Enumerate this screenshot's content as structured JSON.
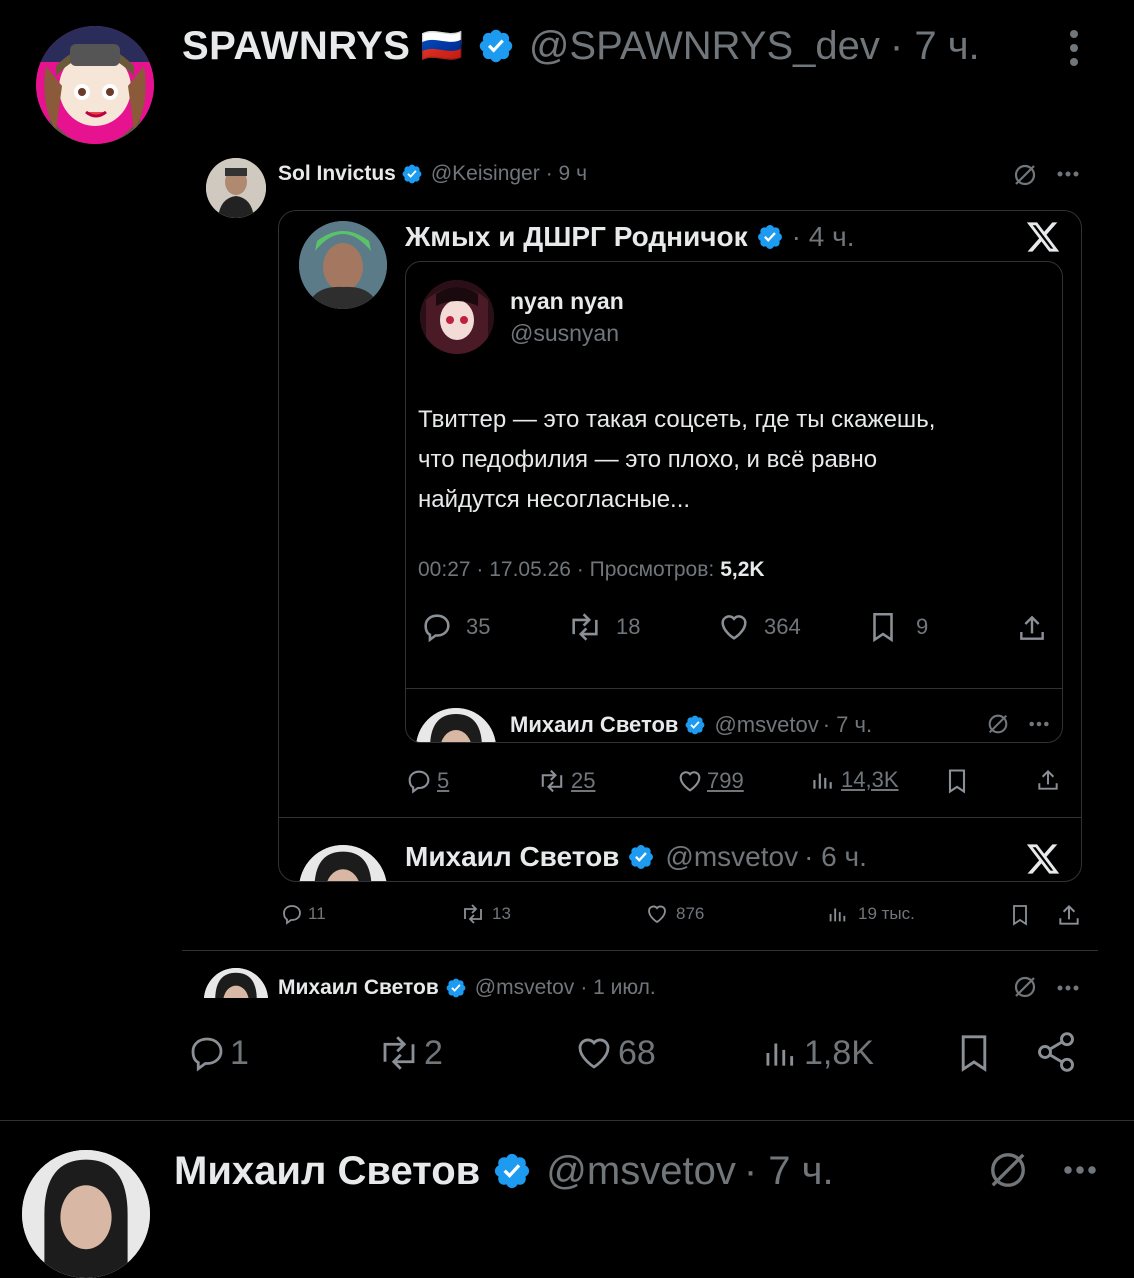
{
  "main_post": {
    "name": "SPAWNRYS",
    "flag": "🇷🇺",
    "handle": "@SPAWNRYS_dev",
    "time": "· 7 ч.",
    "avatar_bg": "#e6128f"
  },
  "sol_post": {
    "name": "Sol Invictus",
    "handle": "@Keisinger",
    "time": "· 9 ч"
  },
  "zhmykh_post": {
    "name": "Жмых и ДШРГ Родничок",
    "time": "· 4 ч."
  },
  "nyan_post": {
    "name": "nyan nyan",
    "handle": "@susnyan",
    "text_line1": "Твиттер — это такая соцсеть, где ты скажешь,",
    "text_line2": "что педофилия — это плохо, и всё равно",
    "text_line3": "найдутся несогласные...",
    "meta": "00:27 · 17.05.26 · Просмотров:",
    "views": "5,2K",
    "stats": {
      "replies": "35",
      "reposts": "18",
      "likes": "364",
      "bookmarks": "9"
    }
  },
  "svetov_inner": {
    "name": "Михаил Светов",
    "handle": "@msvetov",
    "time": "· 7 ч."
  },
  "zhmykh_stats": {
    "replies": "5",
    "reposts": "25",
    "likes": "799",
    "views": "14,3K"
  },
  "svetov_card2": {
    "name": "Михаил Светов",
    "handle": "@msvetov",
    "time": "· 6 ч."
  },
  "sol_stats": {
    "replies": "11",
    "reposts": "13",
    "likes": "876",
    "views": "19 тыс."
  },
  "svetov_post3": {
    "name": "Михаил Светов",
    "handle": "@msvetov",
    "time": "· 1 июл."
  },
  "main_stats": {
    "replies": "1",
    "reposts": "2",
    "likes": "68",
    "views": "1,8K"
  },
  "svetov_bottom": {
    "name": "Михаил Светов",
    "handle": "@msvetov",
    "time": "· 7 ч."
  },
  "colors": {
    "verified": "#1d9bf0",
    "background": "#000000",
    "muted": "#71767b",
    "text": "#e7e9ea"
  }
}
